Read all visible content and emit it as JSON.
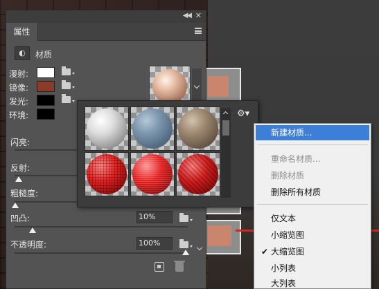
{
  "panel": {
    "tab": "属性",
    "section_title": "材质",
    "properties": [
      {
        "label": "漫射:",
        "color": "#ffffff"
      },
      {
        "label": "镜像:",
        "color": "#8b3b27"
      },
      {
        "label": "发光:",
        "color": "#000000"
      },
      {
        "label": "环境:",
        "color": "#000000"
      }
    ],
    "sliders": [
      {
        "label": "闪亮:",
        "value": null
      },
      {
        "label": "反射:",
        "value": null
      },
      {
        "label": "粗糙度:",
        "value": null
      },
      {
        "label": "凹凸:",
        "value": "10%"
      },
      {
        "label": "不透明度:",
        "value": "100%"
      }
    ]
  },
  "picker": {
    "materials": [
      "white",
      "blue",
      "brown",
      "red-1",
      "red-2",
      "red-3"
    ],
    "gear_icon": "gear-icon"
  },
  "menu": {
    "items": [
      {
        "label": "新建材质...",
        "state": "selected"
      },
      {
        "label": "重命名材质...",
        "state": "disabled"
      },
      {
        "label": "删除材质",
        "state": "disabled"
      },
      {
        "label": "删除所有材质",
        "state": "normal"
      },
      {
        "label": "仅文本",
        "state": "normal"
      },
      {
        "label": "小缩览图",
        "state": "normal"
      },
      {
        "label": "大缩览图",
        "state": "checked"
      },
      {
        "label": "小列表",
        "state": "normal"
      },
      {
        "label": "大列表",
        "state": "normal"
      }
    ]
  },
  "colors": {
    "menu_highlight": "#3c7fd9",
    "panel_bg": "#535353",
    "canvas_red_line": "#d9231f"
  }
}
